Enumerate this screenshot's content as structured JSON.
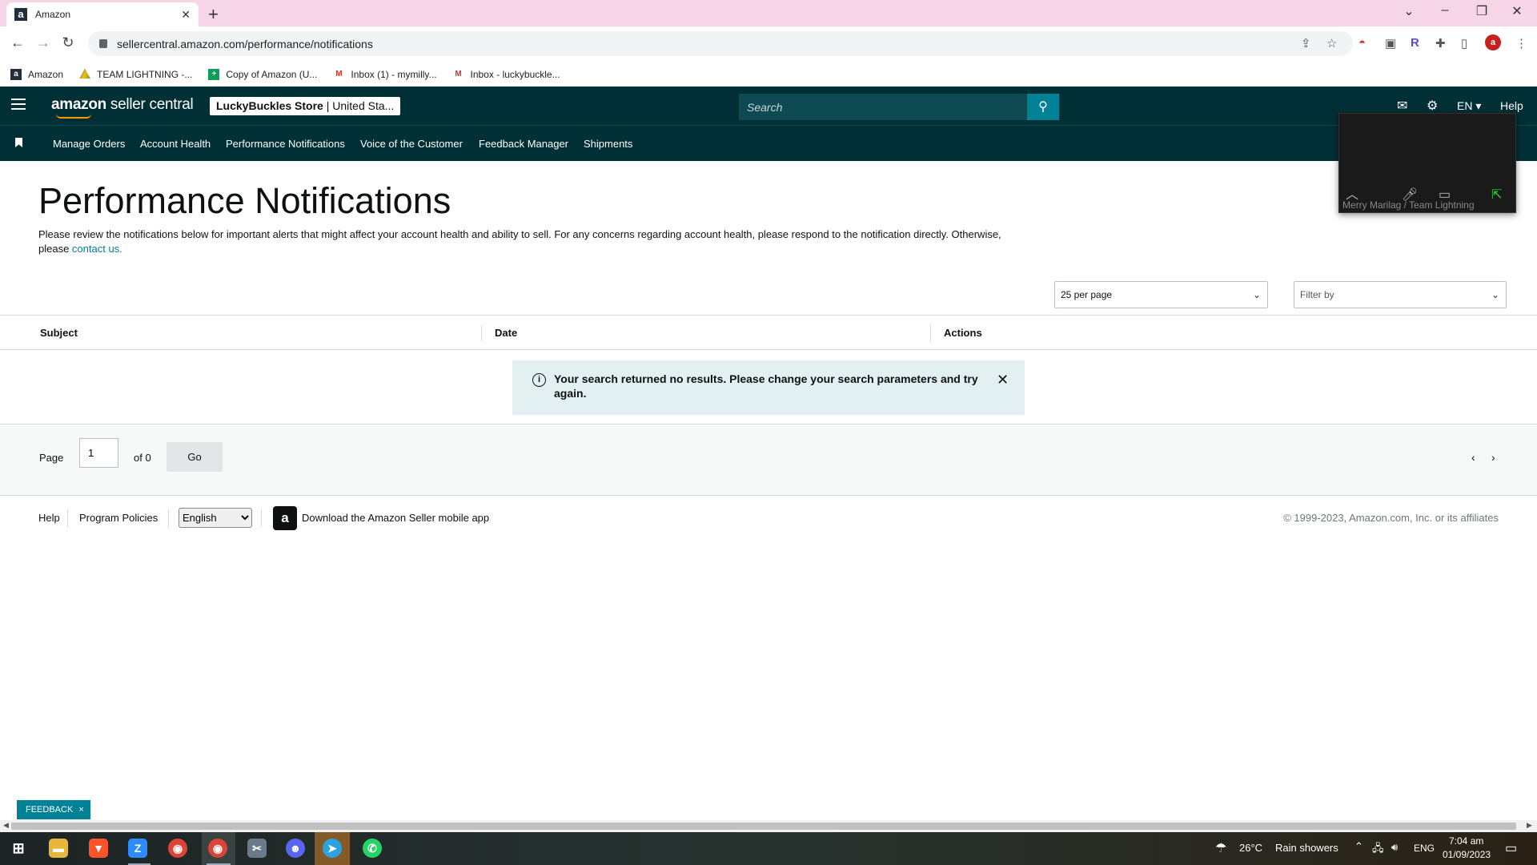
{
  "browser": {
    "tab_title": "Amazon",
    "tab_favicon": "a",
    "new_tab": "+",
    "url": "sellercentral.amazon.com/performance/notifications",
    "profile_initial": "a",
    "bookmarks": [
      {
        "label": "Amazon",
        "icon": "amazon-icon"
      },
      {
        "label": "TEAM LIGHTNING -...",
        "icon": "google-drive-icon"
      },
      {
        "label": "Copy of Amazon (U...",
        "icon": "google-sheets-icon"
      },
      {
        "label": "Inbox (1) - mymilly...",
        "icon": "gmail-icon"
      },
      {
        "label": "Inbox - luckybuckle...",
        "icon": "gmail-icon"
      }
    ]
  },
  "header": {
    "logo_bold": "amazon",
    "logo_light": " seller central",
    "store_name": "LuckyBuckles Store",
    "store_region": " | United Sta...",
    "search_placeholder": "Search",
    "language": "EN ▾",
    "help": "Help"
  },
  "nav": {
    "items": [
      "Manage Orders",
      "Account Health",
      "Performance Notifications",
      "Voice of the Customer",
      "Feedback Manager",
      "Shipments"
    ]
  },
  "video_overlay": {
    "caption": "Merry Marilag / Team Lightning"
  },
  "page": {
    "title": "Performance Notifications",
    "intro": "Please review the notifications below for important alerts that might affect your account health and ability to sell. For any concerns regarding account health, please respond to the notification directly. Otherwise, please ",
    "contact_link": "contact us.",
    "per_page": "25 per page",
    "filter_placeholder": "Filter by"
  },
  "table": {
    "columns": [
      "Subject",
      "Date",
      "Actions"
    ],
    "alert_message": "Your search returned no results. Please change your search parameters and try again."
  },
  "pager": {
    "page_label": "Page",
    "page_value": "1",
    "of_label": "of 0",
    "go_label": "Go"
  },
  "footer": {
    "help": "Help",
    "program_policies": "Program Policies",
    "language_selected": "English",
    "download_app": "Download the Amazon Seller mobile app",
    "copyright": "© 1999-2023, Amazon.com, Inc. or its affiliates"
  },
  "feedback": {
    "label": "FEEDBACK",
    "close": "×"
  },
  "taskbar": {
    "weather_temp": "26°C",
    "weather_desc": "Rain showers",
    "lang": "ENG",
    "time": "7:04 am",
    "date": "01/09/2023"
  },
  "colors": {
    "header_bg": "#002f36",
    "accent_teal": "#008296",
    "alert_bg": "#e3f0f2",
    "tabstrip_bg": "#f5d5e6"
  }
}
